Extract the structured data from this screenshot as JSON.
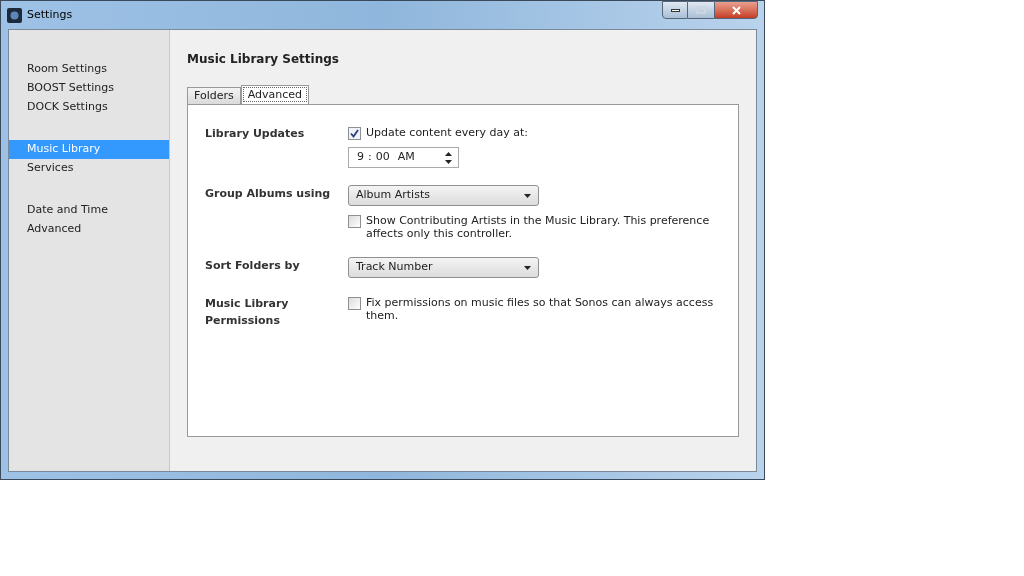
{
  "window": {
    "title": "Settings"
  },
  "sidebar": {
    "groups": [
      {
        "items": [
          {
            "label": "Room Settings",
            "selected": false
          },
          {
            "label": "BOOST Settings",
            "selected": false
          },
          {
            "label": "DOCK Settings",
            "selected": false
          }
        ]
      },
      {
        "items": [
          {
            "label": "Music Library",
            "selected": true
          },
          {
            "label": "Services",
            "selected": false
          }
        ]
      },
      {
        "items": [
          {
            "label": "Date and Time",
            "selected": false
          },
          {
            "label": "Advanced",
            "selected": false
          }
        ]
      }
    ]
  },
  "heading": "Music Library Settings",
  "tabs": [
    {
      "label": "Folders",
      "selected": false
    },
    {
      "label": "Advanced",
      "selected": true
    }
  ],
  "settings": [
    {
      "label": "Library Updates",
      "controls": [
        {
          "kind": "checkbox",
          "label": "Update content every day at:",
          "checked": true
        },
        {
          "kind": "time",
          "hour": "9",
          "separator": ":",
          "minute": "00",
          "period": "AM"
        }
      ]
    },
    {
      "label": "Group Albums using",
      "controls": [
        {
          "kind": "dropdown",
          "value": "Album Artists"
        },
        {
          "kind": "checkbox",
          "label": "Show Contributing Artists in the Music Library. This preference affects only this controller.",
          "checked": false
        }
      ]
    },
    {
      "label": "Sort Folders by",
      "controls": [
        {
          "kind": "dropdown",
          "value": "Track Number"
        }
      ]
    },
    {
      "label": "Music Library Permissions",
      "controls": [
        {
          "kind": "checkbox",
          "label": "Fix permissions on music files so that Sonos can always access them.",
          "checked": false
        }
      ]
    }
  ]
}
